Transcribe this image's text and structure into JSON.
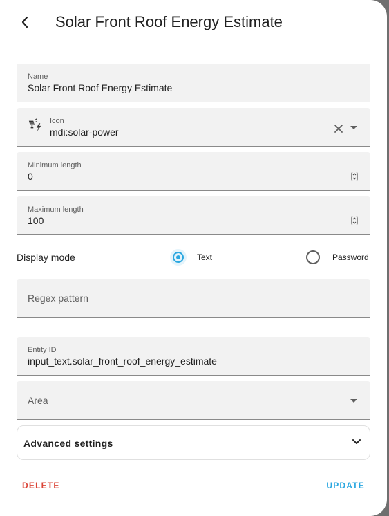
{
  "dialog": {
    "title": "Solar Front Roof Energy Estimate"
  },
  "form": {
    "name": {
      "label": "Name",
      "value": "Solar Front Roof Energy Estimate"
    },
    "icon": {
      "label": "Icon",
      "value": "mdi:solar-power",
      "icon_name": "solar-power-icon"
    },
    "min_length": {
      "label": "Minimum length",
      "value": "0"
    },
    "max_length": {
      "label": "Maximum length",
      "value": "100"
    },
    "display_mode": {
      "label": "Display mode",
      "options": [
        {
          "label": "Text",
          "selected": true
        },
        {
          "label": "Password",
          "selected": false
        }
      ]
    },
    "regex": {
      "placeholder": "Regex pattern",
      "value": ""
    },
    "entity_id": {
      "label": "Entity ID",
      "value": "input_text.solar_front_roof_energy_estimate"
    },
    "area": {
      "placeholder": "Area",
      "value": ""
    },
    "advanced": {
      "label": "Advanced settings"
    }
  },
  "actions": {
    "delete_label": "DELETE",
    "update_label": "UPDATE"
  },
  "colors": {
    "accent": "#2aa7e0",
    "danger": "#db4437",
    "field_bg": "#f2f2f2",
    "overlay": "#6f6f6f"
  }
}
